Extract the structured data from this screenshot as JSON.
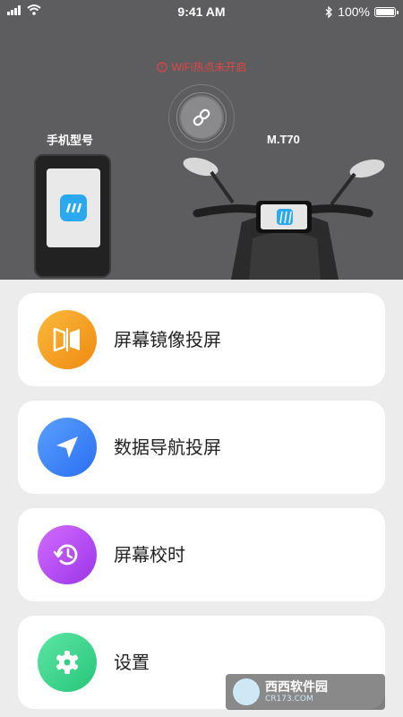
{
  "status_bar": {
    "time": "9:41 AM",
    "battery": "100%"
  },
  "connection": {
    "warning": "WiFi热点未开启"
  },
  "devices": {
    "phone_label": "手机型号",
    "bike_label": "M.T70"
  },
  "menu": [
    {
      "label": "屏幕镜像投屏",
      "icon": "mirror-icon",
      "color": "#f6a21c"
    },
    {
      "label": "数据导航投屏",
      "icon": "navigation-icon",
      "color": "#3b86f5"
    },
    {
      "label": "屏幕校时",
      "icon": "clock-history-icon",
      "color": "#b24bf0"
    },
    {
      "label": "设置",
      "icon": "gear-icon",
      "color": "#3ed48d"
    }
  ],
  "watermark": {
    "title": "西西软件园",
    "subtitle": "CR173.COM"
  }
}
